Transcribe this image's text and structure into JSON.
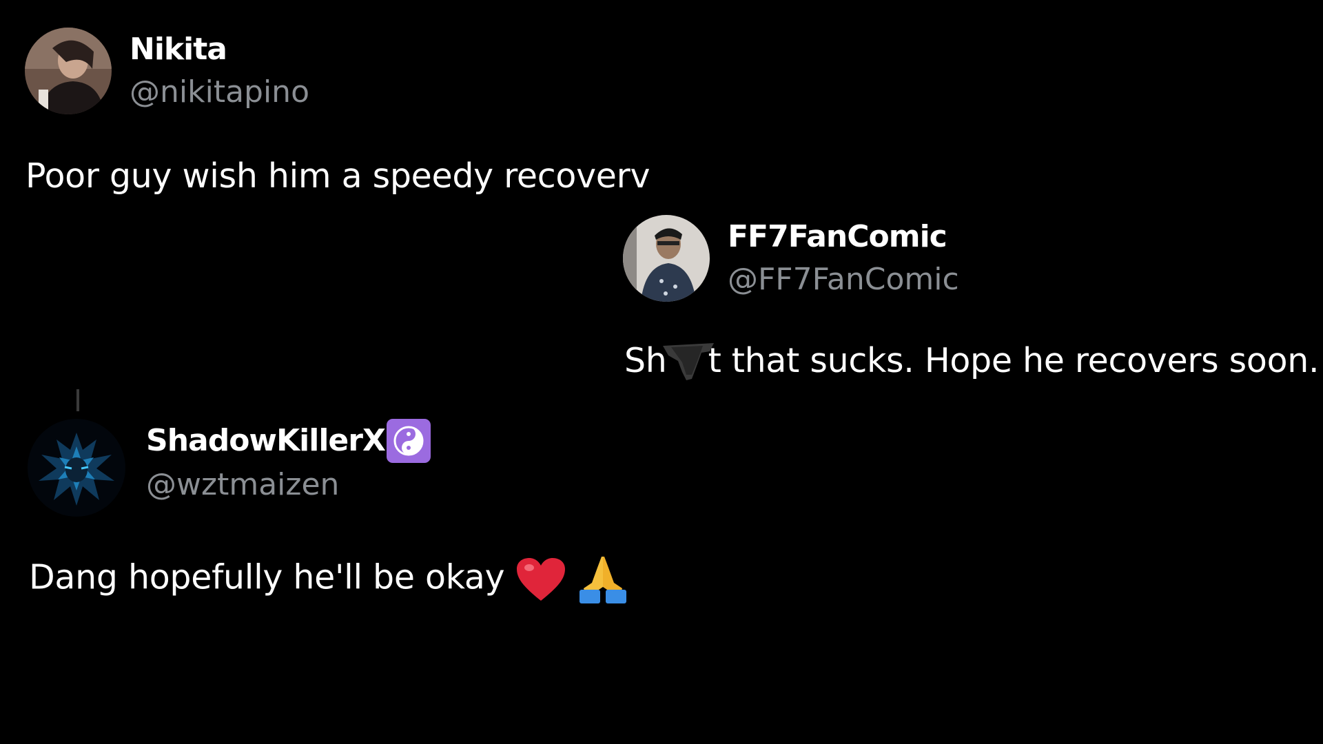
{
  "replies": [
    {
      "display_name": "Nikita",
      "handle": "@nikitapino",
      "text": "Poor guy wish him a speedy recoverv",
      "avatar_icon": "user-avatar-photo"
    },
    {
      "display_name": "FF7FanComic",
      "handle": "@FF7FanComic",
      "text_before": "Sh",
      "text_after": "t that sucks. Hope he recovers soon.",
      "censor_icon": "censor-scribble",
      "avatar_icon": "user-avatar-photo"
    },
    {
      "display_name": "ShadowKillerX",
      "handle": "@wztmaizen",
      "text": "Dang hopefully he'll be okay",
      "badge_icon": "yin-yang-icon",
      "badge_color": "#9b6be0",
      "emojis": [
        "red-heart-emoji",
        "folded-hands-emoji"
      ],
      "avatar_icon": "user-avatar-art"
    }
  ],
  "colors": {
    "background": "#000000",
    "name": "#ffffff",
    "handle": "#8b8f94",
    "text": "#ffffff"
  }
}
